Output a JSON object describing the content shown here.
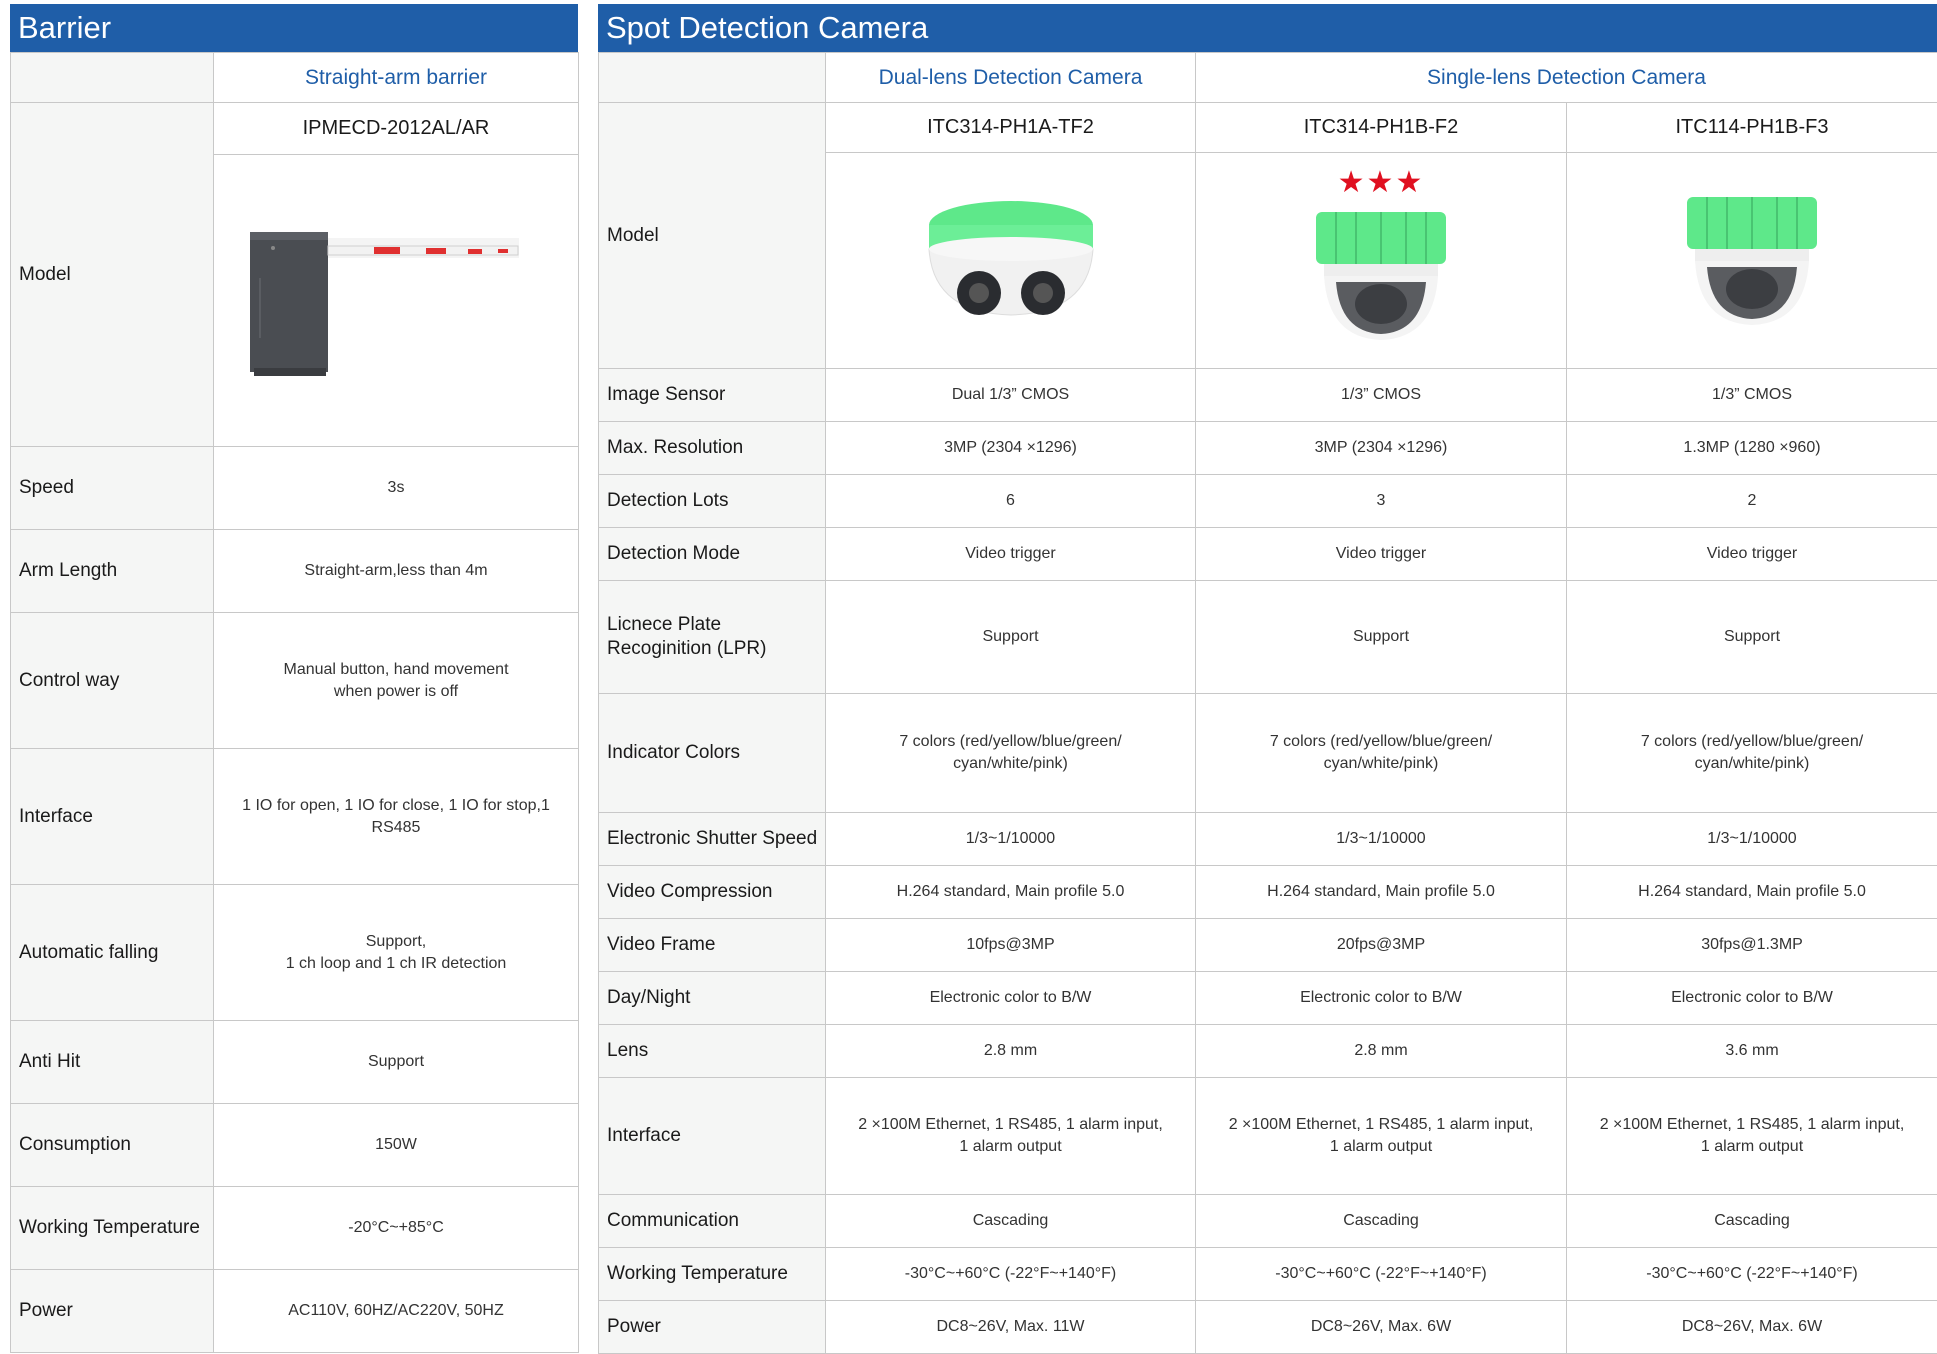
{
  "barrier": {
    "title": "Barrier",
    "subheader": "Straight-arm barrier",
    "model_label": "Model",
    "model_name": "IPMECD-2012AL/AR",
    "rows": [
      {
        "label": "Speed",
        "value": "3s"
      },
      {
        "label": "Arm Length",
        "value": "Straight-arm,less than 4m"
      },
      {
        "label": "Control way",
        "value": "Manual button, hand movement\nwhen power is off"
      },
      {
        "label": "Interface",
        "value": "1 IO for open, 1 IO for close, 1 IO for stop,1\nRS485"
      },
      {
        "label": "Automatic falling",
        "value": "Support,\n1 ch loop and 1 ch IR detection"
      },
      {
        "label": "Anti Hit",
        "value": "Support"
      },
      {
        "label": "Consumption",
        "value": "150W"
      },
      {
        "label": "Working Temperature",
        "value": "-20°C~+85°C"
      },
      {
        "label": "Power",
        "value": "AC110V, 60HZ/AC220V, 50HZ"
      }
    ]
  },
  "camera": {
    "title": "Spot Detection Camera",
    "subheaders": [
      "Dual-lens Detection Camera",
      "Single-lens Detection Camera"
    ],
    "model_label": "Model",
    "models": [
      "ITC314-PH1A-TF2",
      "ITC314-PH1B-F2",
      "ITC114-PH1B-F3"
    ],
    "stars": "★★★",
    "rows": [
      {
        "label": "Image Sensor",
        "values": [
          "Dual 1/3” CMOS",
          "1/3” CMOS",
          "1/3” CMOS"
        ]
      },
      {
        "label": "Max. Resolution",
        "values": [
          "3MP (2304 ×1296)",
          "3MP (2304 ×1296)",
          "1.3MP (1280 ×960)"
        ]
      },
      {
        "label": "Detection Lots",
        "values": [
          "6",
          "3",
          "2"
        ]
      },
      {
        "label": "Detection Mode",
        "values": [
          "Video trigger",
          "Video trigger",
          "Video trigger"
        ]
      },
      {
        "label": "Licnece Plate\nRecoginition (LPR)",
        "values": [
          "Support",
          "Support",
          "Support"
        ]
      },
      {
        "label": "Indicator Colors",
        "values": [
          "7 colors (red/yellow/blue/green/\ncyan/white/pink)",
          "7 colors (red/yellow/blue/green/\ncyan/white/pink)",
          "7 colors (red/yellow/blue/green/\ncyan/white/pink)"
        ]
      },
      {
        "label": "Electronic Shutter Speed",
        "values": [
          "1/3~1/10000",
          "1/3~1/10000",
          "1/3~1/10000"
        ]
      },
      {
        "label": "Video Compression",
        "values": [
          "H.264 standard, Main profile 5.0",
          "H.264 standard, Main profile 5.0",
          "H.264 standard, Main profile 5.0"
        ]
      },
      {
        "label": "Video Frame",
        "values": [
          "10fps@3MP",
          "20fps@3MP",
          "30fps@1.3MP"
        ]
      },
      {
        "label": "Day/Night",
        "values": [
          "Electronic color to B/W",
          "Electronic color to B/W",
          "Electronic color to B/W"
        ]
      },
      {
        "label": "Lens",
        "values": [
          "2.8 mm",
          "2.8 mm",
          "3.6 mm"
        ]
      },
      {
        "label": "Interface",
        "values": [
          "2 ×100M Ethernet, 1 RS485, 1 alarm input,\n1 alarm output",
          "2 ×100M Ethernet, 1 RS485, 1 alarm input,\n1 alarm output",
          "2 ×100M Ethernet, 1 RS485, 1 alarm input,\n1 alarm output"
        ]
      },
      {
        "label": "Communication",
        "values": [
          "Cascading",
          "Cascading",
          "Cascading"
        ]
      },
      {
        "label": "Working Temperature",
        "values": [
          "-30°C~+60°C (-22°F~+140°F)",
          "-30°C~+60°C (-22°F~+140°F)",
          "-30°C~+60°C (-22°F~+140°F)"
        ]
      },
      {
        "label": "Power",
        "values": [
          "DC8~26V, Max. 11W",
          "DC8~26V, Max. 6W",
          "DC8~26V, Max. 6W"
        ]
      }
    ]
  },
  "colors": {
    "header_bg": "#1f5ea8",
    "subheader_text": "#1f5ea8",
    "label_bg": "#f5f6f5",
    "star": "#e01020",
    "camera_ring": "#5ee88a"
  }
}
